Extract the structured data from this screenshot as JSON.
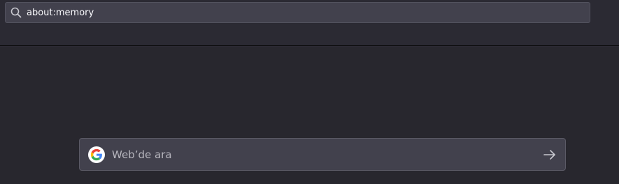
{
  "urlbar": {
    "value": "about:memory",
    "icon": "search-icon"
  },
  "newtab": {
    "search_placeholder": "Web’de ara",
    "engine_icon": "google-logo-icon",
    "go_icon": "arrow-right-icon"
  },
  "colors": {
    "toolbar_bg": "#2b2a33",
    "content_bg": "#28272e",
    "field_bg": "#42414d",
    "text": "#fbfbfe",
    "placeholder": "#b6b5bd"
  }
}
